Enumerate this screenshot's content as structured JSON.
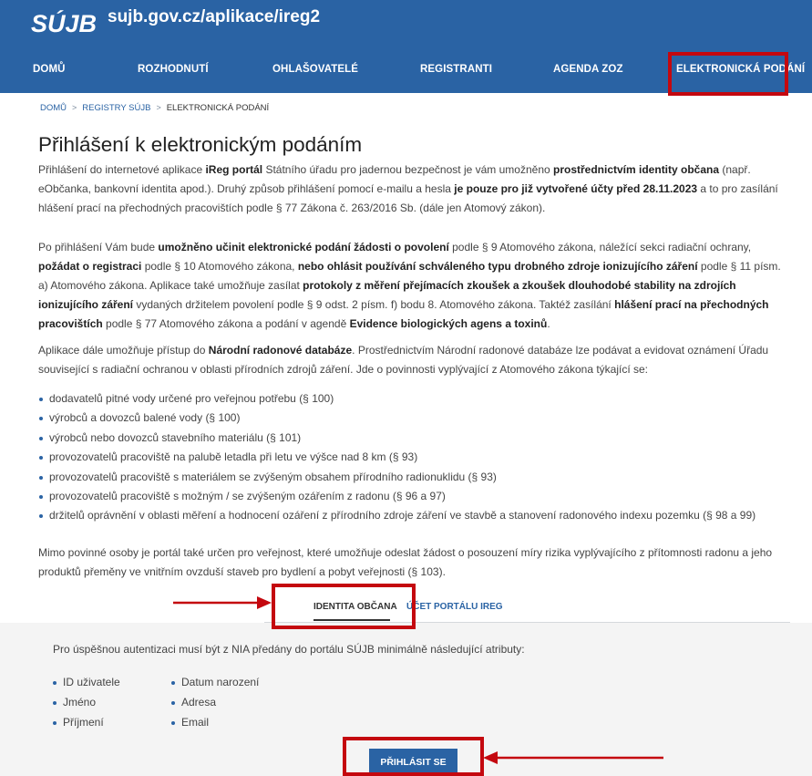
{
  "header": {
    "logo_text": "SÚJB",
    "site_url": "sujb.gov.cz/aplikace/ireg2"
  },
  "nav": {
    "items": [
      {
        "label": "DOMŮ"
      },
      {
        "label": "ROZHODNUTÍ"
      },
      {
        "label": "OHLAŠOVATELÉ"
      },
      {
        "label": "REGISTRANTI"
      },
      {
        "label": "AGENDA ZOZ"
      },
      {
        "label": "ELEKTRONICKÁ PODÁNÍ"
      }
    ]
  },
  "breadcrumb": {
    "items": [
      "DOMŮ",
      "REGISTRY SÚJB",
      "ELEKTRONICKÁ PODÁNÍ"
    ],
    "separator": ">"
  },
  "page": {
    "title": "Přihlášení k elektronickým podáním",
    "p1": {
      "t1": "Přihlášení do internetové aplikace ",
      "b1": "iReg portál",
      "t2": " Státního úřadu pro jadernou bezpečnost je vám umožněno ",
      "b2": "prostřednictvím identity občana",
      "t3": " (např. eObčanka, bankovní identita apod.). Druhý způsob přihlášení pomocí e-mailu a hesla ",
      "b3": "je pouze pro již vytvořené účty před 28.11.2023",
      "t4": " a to pro zasílání hlášení prací na přechodných pracovištích podle § 77 Zákona č. 263/2016 Sb. (dále jen Atomový zákon)."
    },
    "p2": {
      "t1": "Po přihlášení Vám bude ",
      "b1": "umožněno učinit elektronické podání žádosti o povolení",
      "t2": " podle § 9 Atomového zákona, náležící sekci radiační ochrany, ",
      "b2": "požádat o registraci",
      "t3": " podle § 10 Atomového zákona, ",
      "b3": "nebo ohlásit používání schváleného typu drobného zdroje ionizujícího záření",
      "t4": " podle § 11 písm. a) Atomového zákona. Aplikace také umožňuje zasílat ",
      "b4": "protokoly z měření přejímacích zkoušek a zkoušek dlouhodobé stability na zdrojích ionizujícího záření",
      "t5": " vydaných držitelem povolení podle § 9 odst. 2 písm. f) bodu 8. Atomového zákona. Taktéž zasílání ",
      "b5": "hlášení prací na přechodných pracovištích",
      "t6": " podle § 77 Atomového zákona a podání v agendě ",
      "b6": "Evidence biologických agens a toxinů",
      "t7": "."
    },
    "p3": {
      "t1": "Aplikace dále umožňuje přístup do ",
      "b1": "Národní radonové databáze",
      "t2": ". Prostřednictvím Národní radonové databáze lze podávat a evidovat oznámení Úřadu související s radiační ochranou v oblasti přírodních zdrojů záření. Jde o povinnosti vyplývající z Atomového zákona týkající se:"
    },
    "list": [
      "dodavatelů pitné vody určené pro veřejnou potřebu (§ 100)",
      "výrobců a dovozců balené vody (§ 100)",
      "výrobců nebo dovozců stavebního materiálu (§ 101)",
      "provozovatelů pracoviště na palubě letadla při letu ve výšce nad 8 km (§ 93)",
      "provozovatelů pracoviště s materiálem se zvýšeným obsahem přírodního radionuklidu (§ 93)",
      "provozovatelů pracoviště s možným / se zvýšeným ozářením z radonu (§ 96 a 97)",
      "držitelů oprávnění v oblasti měření a hodnocení ozáření z přírodního zdroje záření ve stavbě a stanovení radonového indexu pozemku (§ 98 a 99)"
    ],
    "p4": "Mimo povinné osoby je portál také určen pro veřejnost, které umožňuje odeslat žádost o posouzení míry rizika vyplývajícího z přítomnosti radonu a jeho produktů přeměny ve vnitřním ovzduší staveb pro bydlení a pobyt veřejnosti (§ 103)."
  },
  "tabs": [
    {
      "label": "IDENTITA OBČANA",
      "active": true
    },
    {
      "label": "ÚČET PORTÁLU IREG",
      "active": false
    }
  ],
  "panel": {
    "note": "Pro úspěšnou autentizaci musí být z NIA předány do portálu SÚJB minimálně následující atributy:",
    "attributes_left": [
      "ID uživatele",
      "Jméno",
      "Příjmení"
    ],
    "attributes_right": [
      "Datum narození",
      "Adresa",
      "Email"
    ],
    "login_label": "PŘIHLÁSIT SE"
  },
  "colors": {
    "brand_blue": "#2a63a4",
    "highlight_red": "#c4080f",
    "panel_gray": "#f4f4f4"
  }
}
